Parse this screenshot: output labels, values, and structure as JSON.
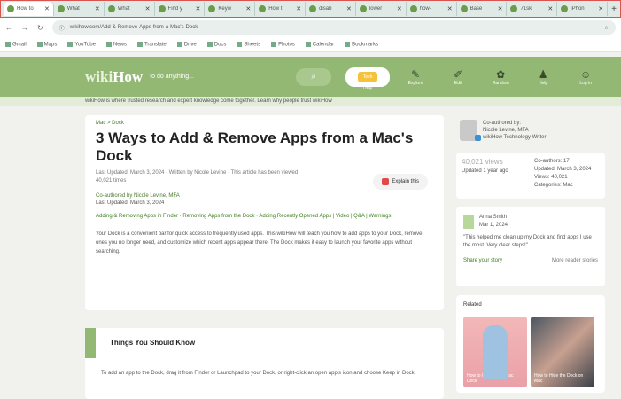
{
  "tabs": [
    {
      "label": "How to"
    },
    {
      "label": "What"
    },
    {
      "label": "What"
    },
    {
      "label": "Find y"
    },
    {
      "label": "Keyw"
    },
    {
      "label": "How t"
    },
    {
      "label": "disab"
    },
    {
      "label": "lower"
    },
    {
      "label": "how-"
    },
    {
      "label": "Base"
    },
    {
      "label": "71sk"
    },
    {
      "label": "iPhon"
    }
  ],
  "new_tab": "+",
  "address": {
    "url": "wikihow.com/Add-&-Remove-Apps-from-a-Mac's-Dock",
    "nav": [
      "←",
      "→",
      "↻"
    ],
    "star": "☆"
  },
  "bookmarks": [
    "Gmail",
    "Maps",
    "YouTube",
    "News",
    "Translate",
    "Drive",
    "Docs",
    "Sheets",
    "Photos",
    "Calendar",
    "Bookmarks"
  ],
  "header": {
    "logo_wiki": "wiki",
    "logo_how": "How",
    "search_placeholder": "to do anything...",
    "search_icon": "⌕",
    "promo": "Tech Help",
    "nav": [
      {
        "icon": "✎",
        "label": "Explore"
      },
      {
        "icon": "✐",
        "label": "Edit"
      },
      {
        "icon": "✿",
        "label": "Random"
      },
      {
        "icon": "♟",
        "label": "Help"
      },
      {
        "icon": "☺",
        "label": "Log in"
      }
    ]
  },
  "banner": "wikiHow is where trusted research and expert knowledge come together. Learn why people trust wikiHow",
  "article": {
    "breadcrumb": "Mac > Dock",
    "title": "3 Ways to Add & Remove Apps from a Mac's Dock",
    "meta": "Last Updated: March 3, 2024 · Written by Nicole Levine · This article has been viewed 40,021 times",
    "explain_button": "Explain this",
    "coauthor": "Co-authored by Nicole Levine, MFA",
    "updated": "Last Updated: March 3, 2024",
    "method_links": "Adding & Removing Apps in Finder · Removing Apps from the Dock · Adding Recently Opened Apps | Video | Q&A | Warnings",
    "intro": "Your Dock is a convenient bar for quick access to frequently used apps. This wikiHow will teach you how to add apps to your Dock, remove ones you no longer need, and customize which recent apps appear there. The Dock makes it easy to launch your favorite apps without searching."
  },
  "section": {
    "title": "Things You Should Know",
    "bullet": "To add an app to the Dock, drag it from Finder or Launchpad to your Dock, or right-click an open app's icon and choose Keep in Dock."
  },
  "sidebar": {
    "author": {
      "line1": "Co-authored by:",
      "line2": "Nicole Levine, MFA",
      "line3": "wikiHow Technology Writer"
    },
    "stats": {
      "views": "40,021 views",
      "label": "Updated 1 year ago",
      "right1": "Co-authors: 17",
      "right2": "Updated: March 3, 2024",
      "right3": "Views: 40,021",
      "right4": "Categories: Mac"
    },
    "review": {
      "name": "Anna Smith",
      "date": "Mar 1, 2024",
      "text": "\"This helped me clean up my Dock and find apps I use the most. Very clear steps!\"",
      "more": "Share your story",
      "count": "More reader stories"
    },
    "related": {
      "title": "Related",
      "items": [
        {
          "caption": "How to Fix a Stuck Mac Dock"
        },
        {
          "caption": "How to Hide the Dock on Mac"
        }
      ]
    }
  }
}
